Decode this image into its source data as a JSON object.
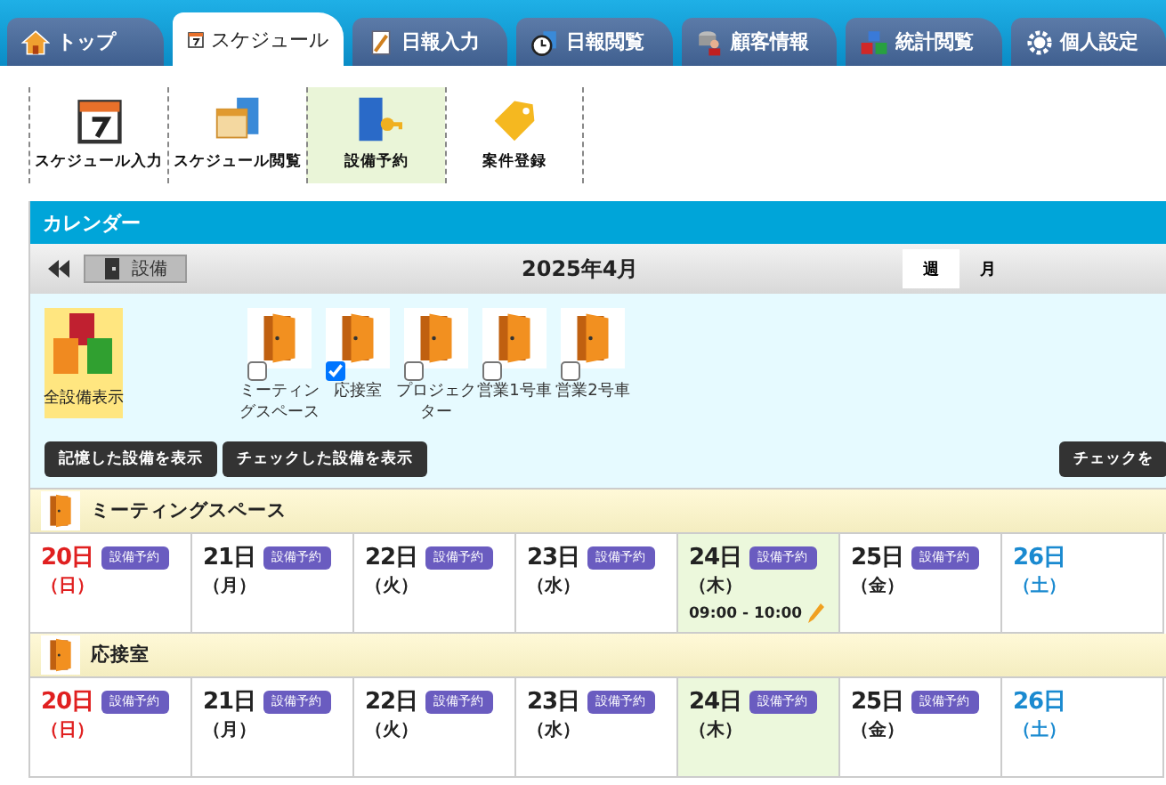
{
  "nav_tabs": [
    {
      "label": "トップ",
      "selected": false
    },
    {
      "label": "スケジュール",
      "selected": true
    },
    {
      "label": "日報入力",
      "selected": false
    },
    {
      "label": "日報閲覧",
      "selected": false
    },
    {
      "label": "顧客情報",
      "selected": false
    },
    {
      "label": "統計閲覧",
      "selected": false
    },
    {
      "label": "個人設定",
      "selected": false
    }
  ],
  "toolbar": [
    {
      "label": "スケジュール入力",
      "selected": false
    },
    {
      "label": "スケジュール閲覧",
      "selected": false
    },
    {
      "label": "設備予約",
      "selected": true
    },
    {
      "label": "案件登録",
      "selected": false
    }
  ],
  "calendar": {
    "title": "カレンダー",
    "equipment_button": "設備",
    "month": "2025年4月",
    "view_tabs": [
      {
        "label": "週",
        "selected": true
      },
      {
        "label": "月",
        "selected": false
      }
    ],
    "all_equipment": {
      "label": "全設備表示",
      "selected": true
    },
    "equipment": [
      {
        "label": "ミーティングスペース",
        "checked": false
      },
      {
        "label": "応接室",
        "checked": true
      },
      {
        "label": "プロジェクター",
        "checked": false
      },
      {
        "label": "営業1号車",
        "checked": false
      },
      {
        "label": "営業2号車",
        "checked": false
      }
    ],
    "buttons": [
      "記憶した設備を表示",
      "チェックした設備を表示"
    ],
    "right_button": "チェックを",
    "sections": [
      {
        "name": "ミーティングスペース",
        "days": [
          {
            "day": "20日",
            "weekday": "（日）",
            "kind": "sunday",
            "today": false,
            "reserve": "設備予約"
          },
          {
            "day": "21日",
            "weekday": "（月）",
            "kind": "weekday",
            "today": false,
            "reserve": "設備予約"
          },
          {
            "day": "22日",
            "weekday": "（火）",
            "kind": "weekday",
            "today": false,
            "reserve": "設備予約"
          },
          {
            "day": "23日",
            "weekday": "（水）",
            "kind": "weekday",
            "today": false,
            "reserve": "設備予約"
          },
          {
            "day": "24日",
            "weekday": "（木）",
            "kind": "weekday",
            "today": true,
            "reserve": "設備予約",
            "events": [
              "09:00 - 10:00"
            ]
          },
          {
            "day": "25日",
            "weekday": "（金）",
            "kind": "weekday",
            "today": false,
            "reserve": "設備予約"
          },
          {
            "day": "26日",
            "weekday": "（土）",
            "kind": "saturday",
            "today": false
          }
        ]
      },
      {
        "name": "応接室",
        "days": [
          {
            "day": "20日",
            "weekday": "（日）",
            "kind": "sunday",
            "today": false,
            "reserve": "設備予約"
          },
          {
            "day": "21日",
            "weekday": "（月）",
            "kind": "weekday",
            "today": false,
            "reserve": "設備予約"
          },
          {
            "day": "22日",
            "weekday": "（火）",
            "kind": "weekday",
            "today": false,
            "reserve": "設備予約"
          },
          {
            "day": "23日",
            "weekday": "（水）",
            "kind": "weekday",
            "today": false,
            "reserve": "設備予約"
          },
          {
            "day": "24日",
            "weekday": "（木）",
            "kind": "weekday",
            "today": true,
            "reserve": "設備予約"
          },
          {
            "day": "25日",
            "weekday": "（金）",
            "kind": "weekday",
            "today": false,
            "reserve": "設備予約"
          },
          {
            "day": "26日",
            "weekday": "（土）",
            "kind": "saturday",
            "today": false
          }
        ]
      }
    ]
  }
}
